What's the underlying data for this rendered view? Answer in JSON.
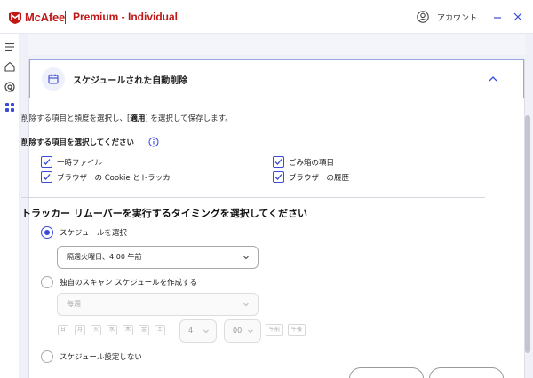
{
  "titlebar": {
    "brand": "McAfee",
    "product": "Premium - Individual",
    "account_label": "アカウント"
  },
  "section": {
    "title": "スケジュールされた自動削除",
    "description_pre": "削除する項目と頻度を選択し、[",
    "description_strong": "適用",
    "description_post": "] を選択して保存します。",
    "items_label": "削除する項目を選択してください",
    "items": [
      {
        "label": "一時ファイル",
        "checked": true
      },
      {
        "label": "ごみ箱の項目",
        "checked": true
      },
      {
        "label": "ブラウザーの Cookie とトラッカー",
        "checked": true
      },
      {
        "label": "ブラウザーの履歴",
        "checked": true
      }
    ],
    "timing_heading": "トラッカー リムーバーを実行するタイミングを選択してください",
    "options": [
      {
        "label": "スケジュールを選択",
        "selected": true
      },
      {
        "label": "独自のスキャン スケジュールを作成する",
        "selected": false
      },
      {
        "label": "スケジュール設定しない",
        "selected": false
      }
    ],
    "schedule_value": "隔週火曜日、4:00 午前",
    "custom_frequency": "毎週",
    "days": [
      "日",
      "月",
      "火",
      "水",
      "木",
      "金",
      "土"
    ],
    "hour": "4",
    "minute": "00",
    "am_label": "午前",
    "pm_label": "午後"
  },
  "colors": {
    "brand_red": "#c01818",
    "accent_blue": "#3a4bd6",
    "background": "#f0f1f8"
  }
}
